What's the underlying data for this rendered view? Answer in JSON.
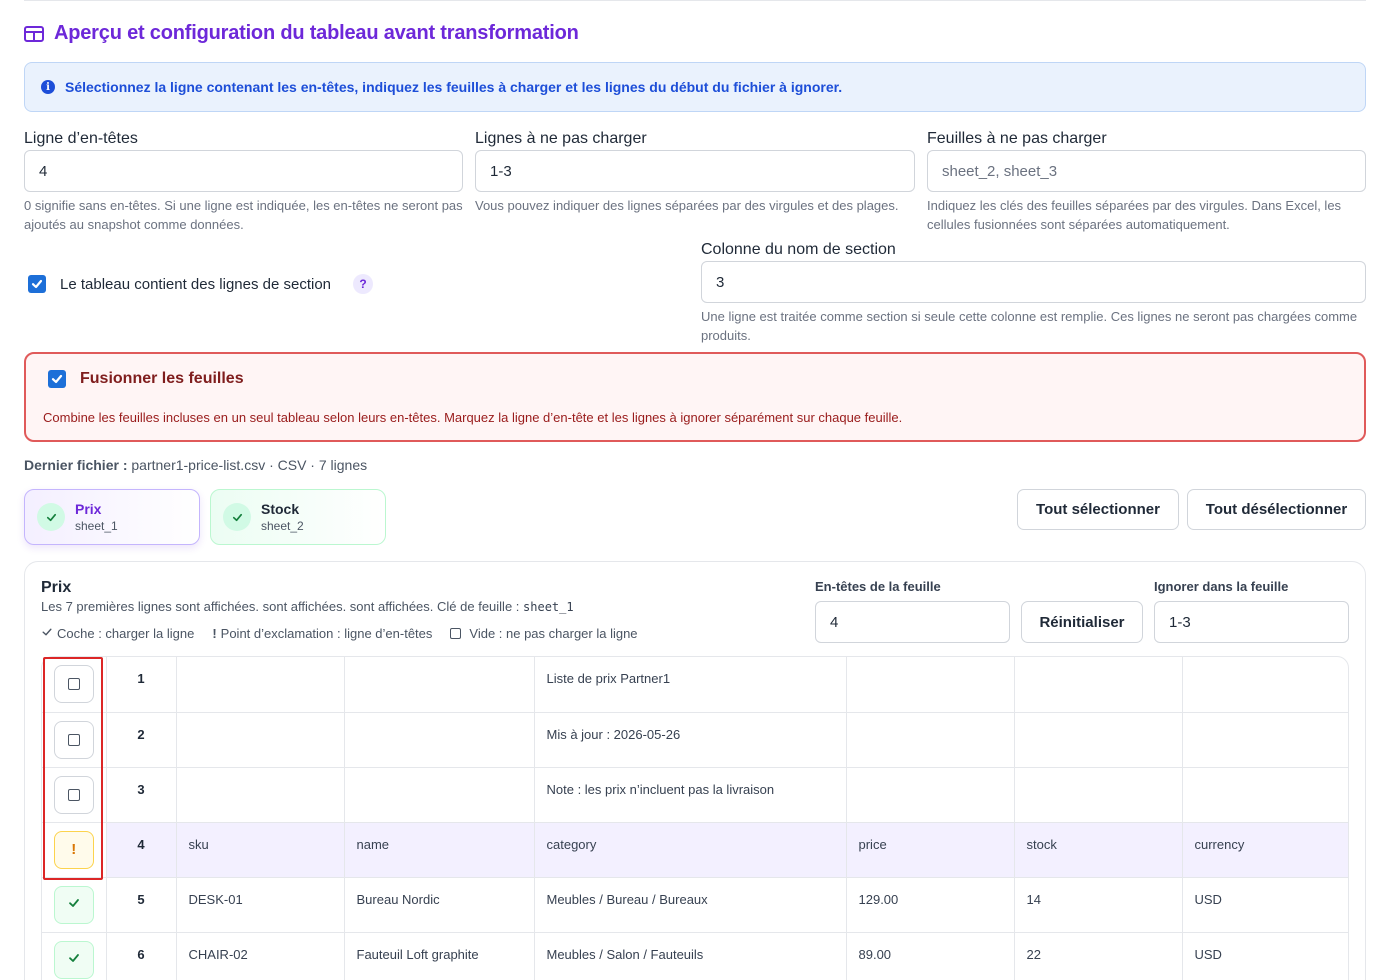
{
  "page": {
    "title": "Aperçu et configuration du tableau avant transformation",
    "info": "Sélectionnez la ligne contenant les en-têtes, indiquez les feuilles à charger et les lignes du début du fichier à ignorer."
  },
  "fields": {
    "header_row": {
      "label": "Ligne d’en-têtes",
      "value": "4",
      "help": "0 signifie sans en-têtes. Si une ligne est indiquée, les en-têtes ne seront pas ajoutés au snapshot comme données."
    },
    "skip_rows": {
      "label": "Lignes à ne pas charger",
      "value": "1-3",
      "help": "Vous pouvez indiquer des lignes séparées par des virgules et des plages."
    },
    "skip_sheets": {
      "label": "Feuilles à ne pas charger",
      "placeholder": "sheet_2, sheet_3",
      "help": "Indiquez les clés des feuilles séparées par des virgules. Dans Excel, les cellules fusionnées sont séparées automatiquement."
    },
    "section_column": {
      "label": "Colonne du nom de section",
      "value": "3",
      "help": "Une ligne est traitée comme section si seule cette colonne est remplie. Ces lignes ne seront pas chargées comme produits."
    }
  },
  "section_rows": {
    "label": "Le tableau contient des lignes de section",
    "checked": true,
    "help_symbol": "?"
  },
  "merge": {
    "title": "Fusionner les feuilles",
    "checked": true,
    "description": "Combine les feuilles incluses en un seul tableau selon leurs en-têtes. Marquez la ligne d’en-tête et les lignes à ignorer séparément sur chaque feuille."
  },
  "last_file": {
    "label": "Dernier fichier :",
    "value": "partner1-price-list.csv · CSV · 7 lignes"
  },
  "sheets": [
    {
      "name": "Prix",
      "key": "sheet_1",
      "active": true
    },
    {
      "name": "Stock",
      "key": "sheet_2",
      "active": false
    }
  ],
  "actions": {
    "select_all": "Tout sélectionner",
    "deselect_all": "Tout désélectionner"
  },
  "panel": {
    "title": "Prix",
    "subtitle": "Les 7 premières lignes sont affichées. sont affichées. sont affichées. Clé de feuille :",
    "sheet_key": "sheet_1",
    "legend": {
      "check": "Coche : charger la ligne",
      "exclaim": "Point d’exclamation : ligne d’en-têtes",
      "empty": "Vide : ne pas charger la ligne"
    },
    "sheet_headers_label": "En-têtes de la feuille",
    "sheet_headers_value": "4",
    "reset": "Réinitialiser",
    "sheet_ignore_label": "Ignorer dans la feuille",
    "sheet_ignore_value": "1-3"
  },
  "rows": [
    {
      "num": "1",
      "state": "empty",
      "cells": [
        "",
        "",
        "Liste de prix Partner1",
        "",
        "",
        ""
      ]
    },
    {
      "num": "2",
      "state": "empty",
      "cells": [
        "",
        "",
        "Mis à jour : 2026-05-26",
        "",
        "",
        ""
      ]
    },
    {
      "num": "3",
      "state": "empty",
      "cells": [
        "",
        "",
        "Note : les prix n’incluent pas la livraison",
        "",
        "",
        ""
      ]
    },
    {
      "num": "4",
      "state": "header",
      "cells": [
        "sku",
        "name",
        "category",
        "price",
        "stock",
        "currency"
      ]
    },
    {
      "num": "5",
      "state": "load",
      "cells": [
        "DESK-01",
        "Bureau Nordic",
        "Meubles / Bureau / Bureaux",
        "129.00",
        "14",
        "USD"
      ]
    },
    {
      "num": "6",
      "state": "load",
      "cells": [
        "CHAIR-02",
        "Fauteuil Loft graphite",
        "Meubles / Salon / Fauteuils",
        "89.00",
        "22",
        "USD"
      ]
    }
  ],
  "colors": {
    "accent": "#6d28d9",
    "info_text": "#1d4ed8",
    "merge_border": "#e05a5a",
    "highlight_red": "#dc2626"
  }
}
